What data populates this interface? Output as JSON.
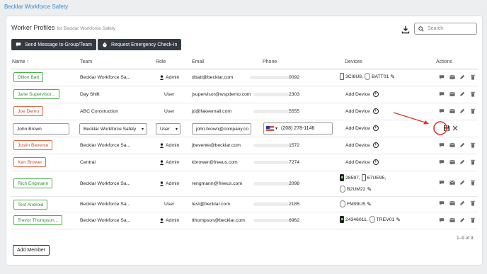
{
  "breadcrumb": "Becklar Workforce Safety",
  "card": {
    "title": "Worker Profiles",
    "subtitle": "for Becklar Workforce Safety",
    "search_placeholder": "Search",
    "send_message_label": "Send Message to Group/Team",
    "emergency_label": "Request Emergency Check-In"
  },
  "columns": {
    "name": "Name",
    "team": "Team",
    "role": "Role",
    "email": "Email",
    "phone": "Phone",
    "devices": "Devices",
    "actions": "Actions"
  },
  "rows": [
    {
      "name": "Dillon Batt",
      "status": "green",
      "team": "Becklar Workforce Sa...",
      "role": "Admin",
      "email": "dbatt@becklar.com",
      "phone_tail": "0092",
      "devices_text": [
        "3CI8U8,",
        "BATT01"
      ]
    },
    {
      "name": "Jane Supervisor...",
      "status": "green",
      "team": "Day Shift",
      "role": "User",
      "email": "jsupervisor@wspdemo.com",
      "phone_tail": "2303",
      "devices_text": [
        "Add Device"
      ]
    },
    {
      "name": "Joe Demo",
      "status": "red",
      "team": "ABC Construction",
      "role": "User",
      "email": "jd@fakeemail.com",
      "phone_tail": "5555",
      "devices_text": [
        "Add Device"
      ]
    },
    {
      "name": "Justin Bevente",
      "status": "red",
      "team": "Becklar Workforce Sa...",
      "role": "Admin",
      "email": "jbevente@becklar.com",
      "phone_tail": "1572",
      "devices_text": [
        "Add Device"
      ]
    },
    {
      "name": "Ken Brower",
      "status": "red",
      "team": "Central",
      "role": "Admin",
      "email": "kbrower@freeus.com",
      "phone_tail": "7274",
      "devices_text": [
        "Add Device"
      ]
    },
    {
      "name": "Rich Engmann",
      "status": "green",
      "team": "Becklar Workforce Sa...",
      "role": "Admin",
      "email": "rengmann@freeus.com",
      "phone_tail": "2098",
      "devices_text": [
        "28597,",
        "67UE95,",
        "B2UM22"
      ]
    },
    {
      "name": "Test Android",
      "status": "green",
      "team": "Becklar Workforce Sa...",
      "role": "User",
      "email": "test@becklar.com",
      "phone_tail": "2185",
      "devices_text": [
        "FM99U5"
      ]
    },
    {
      "name": "Trevor Thompson...",
      "status": "green",
      "team": "Becklar Workforce Sa...",
      "role": "Admin",
      "email": "tthompson@becklar.com",
      "phone_tail": "6962",
      "devices_text": [
        "24346011,",
        "TREV01"
      ]
    }
  ],
  "edit_row": {
    "name_value": "John Brown",
    "team_value": "Becklar Workforce Safety",
    "role_value": "User",
    "email_value": "john.brown@company.co",
    "phone_value": "(208) 278-1146",
    "devices_text": "Add Device"
  },
  "pagination": "1–9 of 9",
  "add_member_label": "Add Member",
  "colors": {
    "active": "#49b04a",
    "inactive": "#e06a45",
    "annotation": "#e0362c"
  }
}
